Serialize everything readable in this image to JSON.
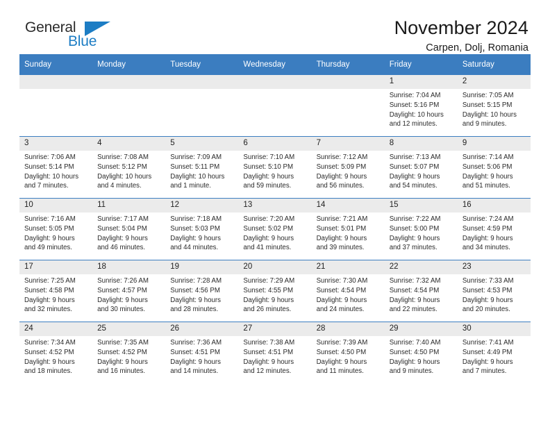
{
  "brand": {
    "name_part1": "General",
    "name_part2": "Blue",
    "accent_color": "#1d7dc4"
  },
  "header": {
    "title": "November 2024",
    "subtitle": "Carpen, Dolj, Romania"
  },
  "calendar": {
    "header_bg": "#3b7dc0",
    "daynum_bg": "#ebebeb",
    "weekday_headers": [
      "Sunday",
      "Monday",
      "Tuesday",
      "Wednesday",
      "Thursday",
      "Friday",
      "Saturday"
    ],
    "weeks": [
      [
        {
          "day": "",
          "lines": []
        },
        {
          "day": "",
          "lines": []
        },
        {
          "day": "",
          "lines": []
        },
        {
          "day": "",
          "lines": []
        },
        {
          "day": "",
          "lines": []
        },
        {
          "day": "1",
          "lines": [
            "Sunrise: 7:04 AM",
            "Sunset: 5:16 PM",
            "Daylight: 10 hours",
            "and 12 minutes."
          ]
        },
        {
          "day": "2",
          "lines": [
            "Sunrise: 7:05 AM",
            "Sunset: 5:15 PM",
            "Daylight: 10 hours",
            "and 9 minutes."
          ]
        }
      ],
      [
        {
          "day": "3",
          "lines": [
            "Sunrise: 7:06 AM",
            "Sunset: 5:14 PM",
            "Daylight: 10 hours",
            "and 7 minutes."
          ]
        },
        {
          "day": "4",
          "lines": [
            "Sunrise: 7:08 AM",
            "Sunset: 5:12 PM",
            "Daylight: 10 hours",
            "and 4 minutes."
          ]
        },
        {
          "day": "5",
          "lines": [
            "Sunrise: 7:09 AM",
            "Sunset: 5:11 PM",
            "Daylight: 10 hours",
            "and 1 minute."
          ]
        },
        {
          "day": "6",
          "lines": [
            "Sunrise: 7:10 AM",
            "Sunset: 5:10 PM",
            "Daylight: 9 hours",
            "and 59 minutes."
          ]
        },
        {
          "day": "7",
          "lines": [
            "Sunrise: 7:12 AM",
            "Sunset: 5:09 PM",
            "Daylight: 9 hours",
            "and 56 minutes."
          ]
        },
        {
          "day": "8",
          "lines": [
            "Sunrise: 7:13 AM",
            "Sunset: 5:07 PM",
            "Daylight: 9 hours",
            "and 54 minutes."
          ]
        },
        {
          "day": "9",
          "lines": [
            "Sunrise: 7:14 AM",
            "Sunset: 5:06 PM",
            "Daylight: 9 hours",
            "and 51 minutes."
          ]
        }
      ],
      [
        {
          "day": "10",
          "lines": [
            "Sunrise: 7:16 AM",
            "Sunset: 5:05 PM",
            "Daylight: 9 hours",
            "and 49 minutes."
          ]
        },
        {
          "day": "11",
          "lines": [
            "Sunrise: 7:17 AM",
            "Sunset: 5:04 PM",
            "Daylight: 9 hours",
            "and 46 minutes."
          ]
        },
        {
          "day": "12",
          "lines": [
            "Sunrise: 7:18 AM",
            "Sunset: 5:03 PM",
            "Daylight: 9 hours",
            "and 44 minutes."
          ]
        },
        {
          "day": "13",
          "lines": [
            "Sunrise: 7:20 AM",
            "Sunset: 5:02 PM",
            "Daylight: 9 hours",
            "and 41 minutes."
          ]
        },
        {
          "day": "14",
          "lines": [
            "Sunrise: 7:21 AM",
            "Sunset: 5:01 PM",
            "Daylight: 9 hours",
            "and 39 minutes."
          ]
        },
        {
          "day": "15",
          "lines": [
            "Sunrise: 7:22 AM",
            "Sunset: 5:00 PM",
            "Daylight: 9 hours",
            "and 37 minutes."
          ]
        },
        {
          "day": "16",
          "lines": [
            "Sunrise: 7:24 AM",
            "Sunset: 4:59 PM",
            "Daylight: 9 hours",
            "and 34 minutes."
          ]
        }
      ],
      [
        {
          "day": "17",
          "lines": [
            "Sunrise: 7:25 AM",
            "Sunset: 4:58 PM",
            "Daylight: 9 hours",
            "and 32 minutes."
          ]
        },
        {
          "day": "18",
          "lines": [
            "Sunrise: 7:26 AM",
            "Sunset: 4:57 PM",
            "Daylight: 9 hours",
            "and 30 minutes."
          ]
        },
        {
          "day": "19",
          "lines": [
            "Sunrise: 7:28 AM",
            "Sunset: 4:56 PM",
            "Daylight: 9 hours",
            "and 28 minutes."
          ]
        },
        {
          "day": "20",
          "lines": [
            "Sunrise: 7:29 AM",
            "Sunset: 4:55 PM",
            "Daylight: 9 hours",
            "and 26 minutes."
          ]
        },
        {
          "day": "21",
          "lines": [
            "Sunrise: 7:30 AM",
            "Sunset: 4:54 PM",
            "Daylight: 9 hours",
            "and 24 minutes."
          ]
        },
        {
          "day": "22",
          "lines": [
            "Sunrise: 7:32 AM",
            "Sunset: 4:54 PM",
            "Daylight: 9 hours",
            "and 22 minutes."
          ]
        },
        {
          "day": "23",
          "lines": [
            "Sunrise: 7:33 AM",
            "Sunset: 4:53 PM",
            "Daylight: 9 hours",
            "and 20 minutes."
          ]
        }
      ],
      [
        {
          "day": "24",
          "lines": [
            "Sunrise: 7:34 AM",
            "Sunset: 4:52 PM",
            "Daylight: 9 hours",
            "and 18 minutes."
          ]
        },
        {
          "day": "25",
          "lines": [
            "Sunrise: 7:35 AM",
            "Sunset: 4:52 PM",
            "Daylight: 9 hours",
            "and 16 minutes."
          ]
        },
        {
          "day": "26",
          "lines": [
            "Sunrise: 7:36 AM",
            "Sunset: 4:51 PM",
            "Daylight: 9 hours",
            "and 14 minutes."
          ]
        },
        {
          "day": "27",
          "lines": [
            "Sunrise: 7:38 AM",
            "Sunset: 4:51 PM",
            "Daylight: 9 hours",
            "and 12 minutes."
          ]
        },
        {
          "day": "28",
          "lines": [
            "Sunrise: 7:39 AM",
            "Sunset: 4:50 PM",
            "Daylight: 9 hours",
            "and 11 minutes."
          ]
        },
        {
          "day": "29",
          "lines": [
            "Sunrise: 7:40 AM",
            "Sunset: 4:50 PM",
            "Daylight: 9 hours",
            "and 9 minutes."
          ]
        },
        {
          "day": "30",
          "lines": [
            "Sunrise: 7:41 AM",
            "Sunset: 4:49 PM",
            "Daylight: 9 hours",
            "and 7 minutes."
          ]
        }
      ]
    ]
  }
}
